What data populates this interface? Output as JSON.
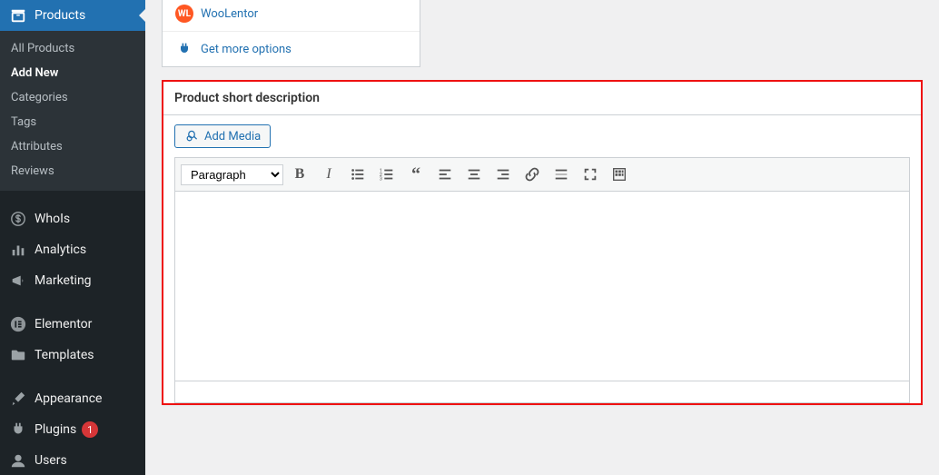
{
  "sidebar": {
    "main_label": "Products",
    "sub_items": [
      {
        "label": "All Products",
        "current": false
      },
      {
        "label": "Add New",
        "current": true
      },
      {
        "label": "Categories",
        "current": false
      },
      {
        "label": "Tags",
        "current": false
      },
      {
        "label": "Attributes",
        "current": false
      },
      {
        "label": "Reviews",
        "current": false
      }
    ],
    "rest": [
      {
        "label": "WhoIs"
      },
      {
        "label": "Analytics"
      },
      {
        "label": "Marketing"
      }
    ],
    "rest2": [
      {
        "label": "Elementor"
      },
      {
        "label": "Templates"
      }
    ],
    "rest3": [
      {
        "label": "Appearance"
      },
      {
        "label": "Plugins",
        "badge": "1"
      },
      {
        "label": "Users"
      }
    ]
  },
  "builder": {
    "rows": [
      {
        "label": "WooLentor",
        "kind": "wl"
      },
      {
        "label": "Get more options",
        "kind": "plug"
      }
    ]
  },
  "desc": {
    "title": "Product short description",
    "add_media": "Add Media",
    "format_options": [
      "Paragraph"
    ],
    "format_value": "Paragraph"
  }
}
